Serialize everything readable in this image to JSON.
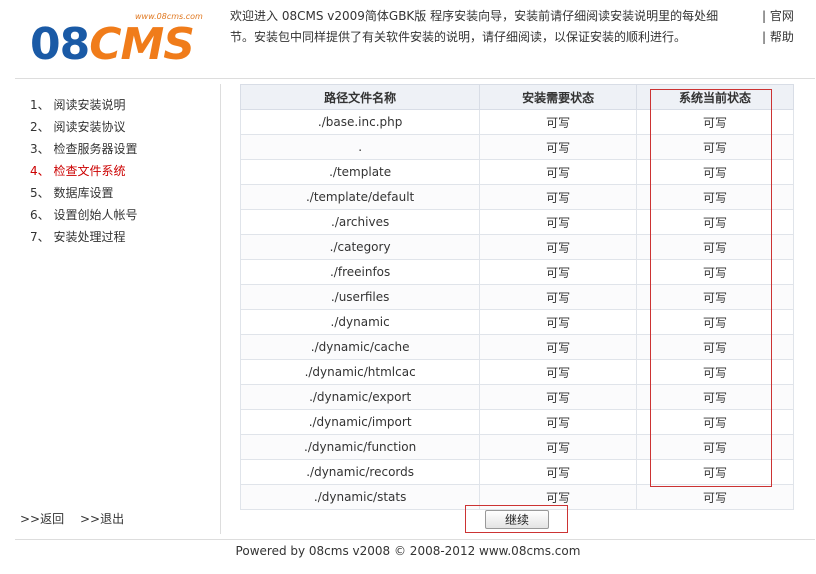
{
  "header": {
    "logo_site": "www.08cms.com",
    "logo_primary": "08",
    "logo_secondary": "CMS",
    "welcome_line1": "欢迎进入 08CMS v2009简体GBK版 程序安装向导，安装前请仔细阅读安装说明里的每处细",
    "welcome_line2": "节。安装包中同样提供了有关软件安装的说明，请仔细阅读，以保证安装的顺利进行。",
    "link_official": "| 官网",
    "link_help": "| 帮助"
  },
  "sidebar": {
    "steps": [
      {
        "label": "1、 阅读安装说明"
      },
      {
        "label": "2、 阅读安装协议"
      },
      {
        "label": "3、 检查服务器设置"
      },
      {
        "label": "4、 检查文件系统"
      },
      {
        "label": "5、 数据库设置"
      },
      {
        "label": "6、 设置创始人帐号"
      },
      {
        "label": "7、 安装处理过程"
      }
    ],
    "active_index": 3,
    "back_link": ">>返回",
    "exit_link": ">>退出"
  },
  "table": {
    "headers": [
      "路径文件名称",
      "安装需要状态",
      "系统当前状态"
    ],
    "rows": [
      [
        "./base.inc.php",
        "可写",
        "可写"
      ],
      [
        ".",
        "可写",
        "可写"
      ],
      [
        "./template",
        "可写",
        "可写"
      ],
      [
        "./template/default",
        "可写",
        "可写"
      ],
      [
        "./archives",
        "可写",
        "可写"
      ],
      [
        "./category",
        "可写",
        "可写"
      ],
      [
        "./freeinfos",
        "可写",
        "可写"
      ],
      [
        "./userfiles",
        "可写",
        "可写"
      ],
      [
        "./dynamic",
        "可写",
        "可写"
      ],
      [
        "./dynamic/cache",
        "可写",
        "可写"
      ],
      [
        "./dynamic/htmlcac",
        "可写",
        "可写"
      ],
      [
        "./dynamic/export",
        "可写",
        "可写"
      ],
      [
        "./dynamic/import",
        "可写",
        "可写"
      ],
      [
        "./dynamic/function",
        "可写",
        "可写"
      ],
      [
        "./dynamic/records",
        "可写",
        "可写"
      ],
      [
        "./dynamic/stats",
        "可写",
        "可写"
      ]
    ]
  },
  "actions": {
    "continue_label": "继续"
  },
  "footer": {
    "text": "Powered by 08cms v2008 © 2008-2012  www.08cms.com"
  },
  "colors": {
    "active_step": "#cc0000",
    "highlight_box": "#cc3333",
    "logo_blue": "#1a5aa6",
    "logo_orange": "#f07c1a"
  }
}
